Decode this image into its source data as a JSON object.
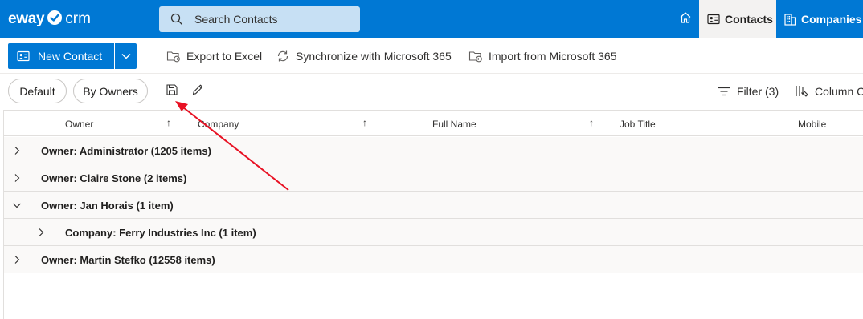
{
  "brand": {
    "name_left": "eway",
    "name_right": "crm"
  },
  "search": {
    "placeholder": "Search Contacts"
  },
  "nav": {
    "home_icon": "home-icon",
    "tabs": [
      {
        "label": "Contacts",
        "icon": "contact-card-icon",
        "active": true
      },
      {
        "label": "Companies",
        "icon": "building-icon",
        "active": false
      }
    ]
  },
  "commands": {
    "new_contact": "New Contact",
    "export_excel": "Export to Excel",
    "sync_m365": "Synchronize with Microsoft 365",
    "import_m365": "Import from Microsoft 365"
  },
  "views": {
    "default_label": "Default",
    "by_owners_label": "By Owners",
    "filter_label": "Filter (3)",
    "columns_label": "Column Chooser"
  },
  "grid": {
    "columns": [
      "Owner",
      "Company",
      "Full Name",
      "Job Title",
      "Mobile"
    ],
    "groups": [
      {
        "label": "Owner: Administrator (1205 items)",
        "expanded": false,
        "level": 0
      },
      {
        "label": "Owner: Claire Stone (2 items)",
        "expanded": false,
        "level": 0
      },
      {
        "label": "Owner: Jan Horais (1 item)",
        "expanded": true,
        "level": 0
      },
      {
        "label": "Company: Ferry Industries Inc (1 item)",
        "expanded": false,
        "level": 1
      },
      {
        "label": "Owner: Martin Stefko (12558 items)",
        "expanded": false,
        "level": 0
      }
    ]
  },
  "colors": {
    "brand_blue": "#0078d4",
    "search_bg": "#c7e0f4",
    "group_row_bg": "#faf9f8",
    "annotation_red": "#e81123"
  }
}
